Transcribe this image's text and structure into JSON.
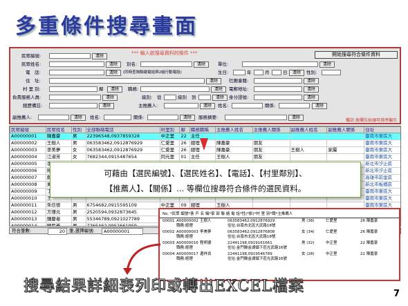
{
  "title": "多重條件搜尋畫面",
  "page_number": "7",
  "form": {
    "header": "*** 輸入欲搜尋資料的條件 ***",
    "search_button": "開始搜尋符合條件資料",
    "note": "備註:按欄位抬頭可排序顯示",
    "labels": [
      "民眾編號:",
      "民眾姓名:",
      "電　話:",
      "住　址:",
      "村 里 別:",
      "負責服務人員:",
      "經歷備註:",
      "副推薦人:",
      "別名:",
      "單位:",
      "生日:",
      "社團會籍:",
      "電郵地址:",
      "職務:",
      "年",
      "月",
      "日",
      "性別:",
      "身分證號:",
      "主推薦人:",
      "姓名:",
      "關係:",
      "服務摘要:"
    ],
    "hint_phone": "(同時查詢聯絡電話與2組行動電話)",
    "clear": "清除",
    "postcode": "鄰",
    "level_from": "級別:",
    "level_from2": "從",
    "level_to": "級別",
    "level_to2": "到"
  },
  "grid": {
    "columns": [
      "民眾編號",
      "民眾姓名",
      "性別",
      "全部聯絡電話",
      "村里別",
      "鄰",
      "職務職稱",
      "主推薦人姓名",
      "主推薦人關係",
      "副推薦人姓名",
      "副推薦人關係",
      "住址"
    ],
    "rows": [
      [
        "A00000001",
        "陳嘉豪",
        "男",
        "22396548,0937859328",
        "中正里",
        "22",
        "主任",
        "",
        "",
        "",
        "",
        "臺南市東區大"
      ],
      [
        "A00000002",
        "王樹人",
        "男",
        "063583462,0912876929",
        "仁愛里",
        "26",
        "經理",
        "陳嘉豪",
        "朋友",
        "",
        "",
        "臺南市東區大"
      ],
      [
        "A00000003",
        "李美夢",
        "女",
        "063583462,0912876929",
        "仁愛里",
        "26",
        "經理",
        "陳嘉豪",
        "朋友",
        "王樹人",
        "家屬",
        "臺南市東區大"
      ],
      [
        "A00000004",
        "江淑芳",
        "女",
        "7682344,0915487654",
        "同元里",
        "01",
        "主任",
        "王樹人",
        "朋友",
        "",
        "",
        "臺南市東區大"
      ],
      [
        "A00000005",
        "李",
        "",
        "",
        "",
        "",
        "",
        "",
        "",
        "",
        "",
        "新北市汐止區"
      ],
      [
        "A00000006",
        "陳",
        "",
        "",
        "",
        "",
        "",
        "",
        "",
        "",
        "",
        "新北市汐止區"
      ],
      [
        "A00000007",
        "鄭",
        "",
        "",
        "",
        "",
        "",
        "",
        "",
        "",
        "",
        "高雄市前金區"
      ],
      [
        "A00000008",
        "黃",
        "",
        "",
        "",
        "",
        "",
        "",
        "",
        "",
        "",
        "新北市板橋區"
      ],
      [
        "A00000009",
        "丁",
        "",
        "",
        "",
        "",
        "",
        "",
        "",
        "",
        "",
        "臺南市東區大"
      ],
      [
        "A00000010",
        "王",
        "",
        "",
        "",
        "",
        "",
        "",
        "",
        "",
        "",
        "臺南市東區大"
      ],
      [
        "A00000011",
        "朱信德",
        "男",
        "6754682,0915595109",
        "中正里",
        "09",
        "經理",
        "王樹人",
        "",
        "",
        "",
        "臺南市東區大"
      ],
      [
        "A00000012",
        "方瑾元",
        "男",
        "2520594,0932873645",
        "中正里",
        "",
        "",
        "",
        "",
        "",
        "",
        "臺南市東區大"
      ],
      [
        "A00000013",
        "鍾慶者",
        "男",
        "55346789,0921027789",
        "中正里",
        "22",
        "",
        "",
        "",
        "",
        "",
        "臺南市東區大"
      ],
      [
        "A00000014",
        "陳民義",
        "男",
        "7765462,0952661959",
        "",
        "",
        "",
        "",
        "",
        "",
        "",
        "臺南市東區大"
      ],
      [
        "A00000015",
        "張穗美",
        "女",
        "6678543,092892878966",
        "",
        "",
        "",
        "",
        "",
        "",
        "",
        "臺南市東區大"
      ]
    ]
  },
  "footer": {
    "count_label": "符合筆數:",
    "count": "20",
    "selected_label": "筆,選擇編號:",
    "selected": "A00000001"
  },
  "callout": {
    "line1": "可藉由【選民編號】、【選民姓名】、【電話】、【村里鄰別】、",
    "line2": "【推薦人】、【關係】... 等欄位搜尋符合條件的選民資料。"
  },
  "report": {
    "header": "No.  *民眾  編號*客 戶 名 稱*家 部    聯  絡  電  話*性(*齡)*村  里  別*職*主推薦人",
    "rows": [
      {
        "no": "00001",
        "id": "A00000002",
        "name": "王樹人",
        "phone": "063583462,0912876929",
        "sex": "男 (38)",
        "vil": "仁愛里",
        "ref": "26 陳嘉豪",
        "addr": "住址:台南市北區大武路18號",
        "job": "職務:經理"
      },
      {
        "no": "00002",
        "id": "A00000003",
        "name": "李美夢",
        "phone": "063583462,0912876808",
        "sex": "女 (34)",
        "vil": "仁愛里",
        "ref": "26 陳嘉豪",
        "addr": "住址:台南市北區大武路18號",
        "job": "職務:經理"
      },
      {
        "no": "00003",
        "id": "A00000016",
        "name": "程明德",
        "phone": "22441198,0919161661",
        "sex": "男 (32)",
        "vil": "中正里",
        "ref": "22 陳嘉豪",
        "addr": "住址:金門縣金湖鎮下莊光武路16號",
        "job": "職務:經理"
      },
      {
        "no": "00004",
        "id": "A00000017",
        "name": "邊祥貞",
        "phone": "22441198,0919546789",
        "sex": "女 (28)",
        "vil": "中正里",
        "ref": "22 陳嘉豪",
        "addr": "住址:金門縣金湖鎮下莊光武路16號",
        "job": "職務:經理"
      }
    ]
  },
  "bottom_caption": "搜尋結果詳細表列印或轉出EXCEL檔案"
}
